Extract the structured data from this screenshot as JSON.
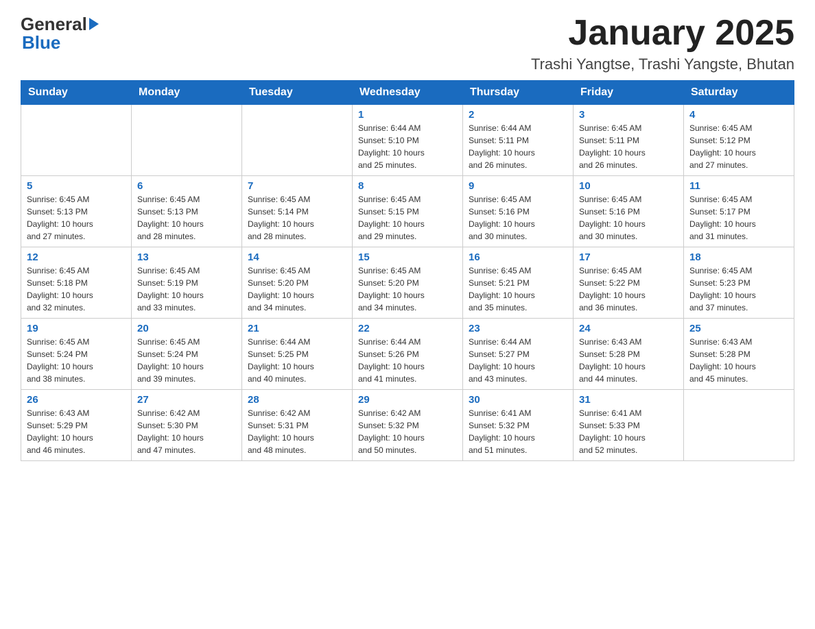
{
  "header": {
    "logo_general": "General",
    "logo_blue": "Blue",
    "month_title": "January 2025",
    "location": "Trashi Yangtse, Trashi Yangste, Bhutan"
  },
  "weekdays": [
    "Sunday",
    "Monday",
    "Tuesday",
    "Wednesday",
    "Thursday",
    "Friday",
    "Saturday"
  ],
  "weeks": [
    [
      {
        "day": "",
        "info": ""
      },
      {
        "day": "",
        "info": ""
      },
      {
        "day": "",
        "info": ""
      },
      {
        "day": "1",
        "info": "Sunrise: 6:44 AM\nSunset: 5:10 PM\nDaylight: 10 hours\nand 25 minutes."
      },
      {
        "day": "2",
        "info": "Sunrise: 6:44 AM\nSunset: 5:11 PM\nDaylight: 10 hours\nand 26 minutes."
      },
      {
        "day": "3",
        "info": "Sunrise: 6:45 AM\nSunset: 5:11 PM\nDaylight: 10 hours\nand 26 minutes."
      },
      {
        "day": "4",
        "info": "Sunrise: 6:45 AM\nSunset: 5:12 PM\nDaylight: 10 hours\nand 27 minutes."
      }
    ],
    [
      {
        "day": "5",
        "info": "Sunrise: 6:45 AM\nSunset: 5:13 PM\nDaylight: 10 hours\nand 27 minutes."
      },
      {
        "day": "6",
        "info": "Sunrise: 6:45 AM\nSunset: 5:13 PM\nDaylight: 10 hours\nand 28 minutes."
      },
      {
        "day": "7",
        "info": "Sunrise: 6:45 AM\nSunset: 5:14 PM\nDaylight: 10 hours\nand 28 minutes."
      },
      {
        "day": "8",
        "info": "Sunrise: 6:45 AM\nSunset: 5:15 PM\nDaylight: 10 hours\nand 29 minutes."
      },
      {
        "day": "9",
        "info": "Sunrise: 6:45 AM\nSunset: 5:16 PM\nDaylight: 10 hours\nand 30 minutes."
      },
      {
        "day": "10",
        "info": "Sunrise: 6:45 AM\nSunset: 5:16 PM\nDaylight: 10 hours\nand 30 minutes."
      },
      {
        "day": "11",
        "info": "Sunrise: 6:45 AM\nSunset: 5:17 PM\nDaylight: 10 hours\nand 31 minutes."
      }
    ],
    [
      {
        "day": "12",
        "info": "Sunrise: 6:45 AM\nSunset: 5:18 PM\nDaylight: 10 hours\nand 32 minutes."
      },
      {
        "day": "13",
        "info": "Sunrise: 6:45 AM\nSunset: 5:19 PM\nDaylight: 10 hours\nand 33 minutes."
      },
      {
        "day": "14",
        "info": "Sunrise: 6:45 AM\nSunset: 5:20 PM\nDaylight: 10 hours\nand 34 minutes."
      },
      {
        "day": "15",
        "info": "Sunrise: 6:45 AM\nSunset: 5:20 PM\nDaylight: 10 hours\nand 34 minutes."
      },
      {
        "day": "16",
        "info": "Sunrise: 6:45 AM\nSunset: 5:21 PM\nDaylight: 10 hours\nand 35 minutes."
      },
      {
        "day": "17",
        "info": "Sunrise: 6:45 AM\nSunset: 5:22 PM\nDaylight: 10 hours\nand 36 minutes."
      },
      {
        "day": "18",
        "info": "Sunrise: 6:45 AM\nSunset: 5:23 PM\nDaylight: 10 hours\nand 37 minutes."
      }
    ],
    [
      {
        "day": "19",
        "info": "Sunrise: 6:45 AM\nSunset: 5:24 PM\nDaylight: 10 hours\nand 38 minutes."
      },
      {
        "day": "20",
        "info": "Sunrise: 6:45 AM\nSunset: 5:24 PM\nDaylight: 10 hours\nand 39 minutes."
      },
      {
        "day": "21",
        "info": "Sunrise: 6:44 AM\nSunset: 5:25 PM\nDaylight: 10 hours\nand 40 minutes."
      },
      {
        "day": "22",
        "info": "Sunrise: 6:44 AM\nSunset: 5:26 PM\nDaylight: 10 hours\nand 41 minutes."
      },
      {
        "day": "23",
        "info": "Sunrise: 6:44 AM\nSunset: 5:27 PM\nDaylight: 10 hours\nand 43 minutes."
      },
      {
        "day": "24",
        "info": "Sunrise: 6:43 AM\nSunset: 5:28 PM\nDaylight: 10 hours\nand 44 minutes."
      },
      {
        "day": "25",
        "info": "Sunrise: 6:43 AM\nSunset: 5:28 PM\nDaylight: 10 hours\nand 45 minutes."
      }
    ],
    [
      {
        "day": "26",
        "info": "Sunrise: 6:43 AM\nSunset: 5:29 PM\nDaylight: 10 hours\nand 46 minutes."
      },
      {
        "day": "27",
        "info": "Sunrise: 6:42 AM\nSunset: 5:30 PM\nDaylight: 10 hours\nand 47 minutes."
      },
      {
        "day": "28",
        "info": "Sunrise: 6:42 AM\nSunset: 5:31 PM\nDaylight: 10 hours\nand 48 minutes."
      },
      {
        "day": "29",
        "info": "Sunrise: 6:42 AM\nSunset: 5:32 PM\nDaylight: 10 hours\nand 50 minutes."
      },
      {
        "day": "30",
        "info": "Sunrise: 6:41 AM\nSunset: 5:32 PM\nDaylight: 10 hours\nand 51 minutes."
      },
      {
        "day": "31",
        "info": "Sunrise: 6:41 AM\nSunset: 5:33 PM\nDaylight: 10 hours\nand 52 minutes."
      },
      {
        "day": "",
        "info": ""
      }
    ]
  ]
}
